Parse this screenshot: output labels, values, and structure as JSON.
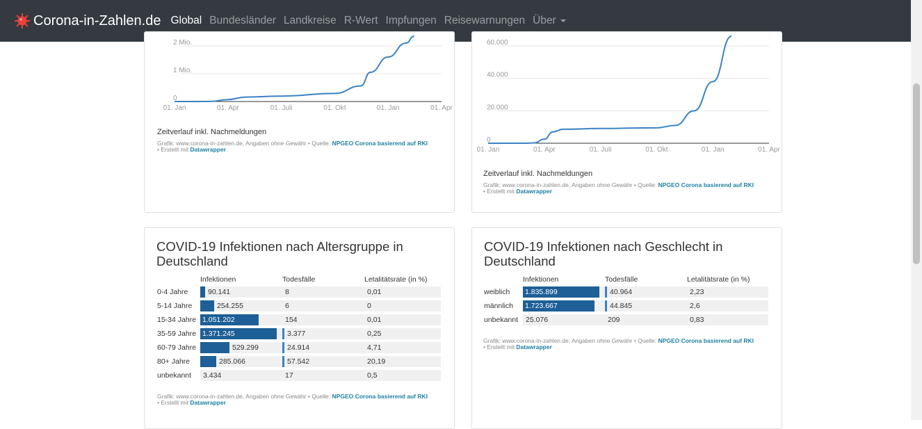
{
  "brand": {
    "title": "Corona-in-Zahlen.de"
  },
  "nav": [
    {
      "label": "Global",
      "active": true
    },
    {
      "label": "Bundesländer"
    },
    {
      "label": "Landkreise"
    },
    {
      "label": "R-Wert"
    },
    {
      "label": "Impfungen"
    },
    {
      "label": "Reisewarnungen"
    },
    {
      "label": "Über",
      "dropdown": true
    }
  ],
  "source_prefix": "Grafik: www.corona-in-zahlen.de, Angaben ohne Gewähr • Quelle:",
  "source_link": "NPGEO Corona basierend auf RKI",
  "created_prefix": "• Erstellt mit",
  "created_link": "Datawrapper",
  "chart_left": {
    "chart_data": {
      "type": "line",
      "note": "Zeitverlauf inkl. Nachmeldungen",
      "x_ticks": [
        "01. Jan",
        "01. Apr",
        "01. Juli",
        "01. Okt",
        "01. Jan",
        "01. Apr"
      ],
      "y_ticks": [
        "0",
        "1 Mio.",
        "2 Mio."
      ],
      "ylim": [
        0,
        2000000
      ],
      "series": [
        {
          "x": [
            "01. Jan",
            "01. Mär",
            "01. Apr",
            "01. Mai",
            "01. Juli",
            "01. Okt",
            "15. Nov",
            "01. Dez",
            "01. Jan",
            "01. Feb",
            "15. Feb"
          ],
          "values": [
            0,
            2000,
            70000,
            160000,
            195000,
            290000,
            560000,
            1050000,
            1600000,
            2100000,
            2350000
          ]
        }
      ],
      "color": "#3a82c4"
    }
  },
  "chart_right": {
    "chart_data": {
      "type": "line",
      "note": "Zeitverlauf inkl. Nachmeldungen",
      "x_ticks": [
        "01. Jan",
        "01. Apr",
        "01. Juli",
        "01. Okt",
        "01. Jan",
        "01. Apr"
      ],
      "y_ticks": [
        "0",
        "20.000",
        "40.000",
        "60.000"
      ],
      "ylim": [
        0,
        60000
      ],
      "series": [
        {
          "x": [
            "01. Jan",
            "01. Mär",
            "15. Mär",
            "01. Apr",
            "15. Apr",
            "01. Mai",
            "01. Juli",
            "01. Okt",
            "01. Nov",
            "01. Dez",
            "01. Jan",
            "01. Feb"
          ],
          "values": [
            0,
            0,
            200,
            2500,
            7000,
            8600,
            9100,
            9500,
            11000,
            20000,
            38000,
            66000
          ]
        }
      ],
      "color": "#3a82c4"
    }
  },
  "age_table": {
    "title": "COVID-19 Infektionen nach Altersgruppe in Deutschland",
    "columns": [
      "Infektionen",
      "Todesfälle",
      "Letalitätsrate (in %)"
    ],
    "rows": [
      {
        "label": "0-4 Jahre",
        "infektionen": "90.141",
        "inf_value": 90141,
        "todesfaelle": "8",
        "tod_value": 8,
        "rate": "0,01"
      },
      {
        "label": "5-14 Jahre",
        "infektionen": "254.255",
        "inf_value": 254255,
        "todesfaelle": "6",
        "tod_value": 6,
        "rate": "0"
      },
      {
        "label": "15-34 Jahre",
        "infektionen": "1.051.202",
        "inf_value": 1051202,
        "todesfaelle": "154",
        "tod_value": 154,
        "rate": "0,01"
      },
      {
        "label": "35-59 Jahre",
        "infektionen": "1.371.245",
        "inf_value": 1371245,
        "todesfaelle": "3.377",
        "tod_value": 3377,
        "rate": "0,25"
      },
      {
        "label": "60-79 Jahre",
        "infektionen": "529.299",
        "inf_value": 529299,
        "todesfaelle": "24.914",
        "tod_value": 24914,
        "rate": "4,71"
      },
      {
        "label": "80+ Jahre",
        "infektionen": "285.066",
        "inf_value": 285066,
        "todesfaelle": "57.542",
        "tod_value": 57542,
        "rate": "20,19"
      },
      {
        "label": "unbekannt",
        "infektionen": "3.434",
        "inf_value": 3434,
        "todesfaelle": "17",
        "tod_value": 17,
        "rate": "0,5"
      }
    ]
  },
  "gender_table": {
    "title": "COVID-19 Infektionen nach Geschlecht in Deutschland",
    "columns": [
      "Infektionen",
      "Todesfälle",
      "Letalitätsrate (in %)"
    ],
    "rows": [
      {
        "label": "weiblich",
        "infektionen": "1.835.899",
        "inf_value": 1835899,
        "todesfaelle": "40.964",
        "tod_value": 40964,
        "rate": "2,23"
      },
      {
        "label": "männlich",
        "infektionen": "1.723.667",
        "inf_value": 1723667,
        "todesfaelle": "44.845",
        "tod_value": 44845,
        "rate": "2,6"
      },
      {
        "label": "unbekannt",
        "infektionen": "25.076",
        "inf_value": 25076,
        "todesfaelle": "209",
        "tod_value": 209,
        "rate": "0,83"
      }
    ]
  }
}
